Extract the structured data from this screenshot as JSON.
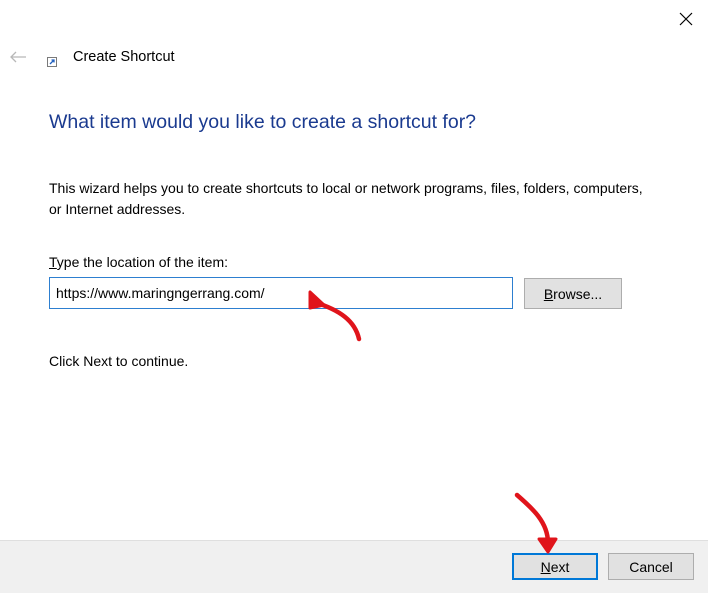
{
  "window": {
    "title": "Create Shortcut"
  },
  "wizard": {
    "heading": "What item would you like to create a shortcut for?",
    "description": "This wizard helps you to create shortcuts to local or network programs, files, folders, computers, or Internet addresses.",
    "location_label_access_key": "T",
    "location_label_rest": "ype the location of the item:",
    "location_value": "https://www.maringngerrang.com/",
    "browse_access_key": "B",
    "browse_rest": "rowse...",
    "hint": "Click Next to continue."
  },
  "footer": {
    "next_access_key": "N",
    "next_rest": "ext",
    "cancel_label": "Cancel"
  },
  "colors": {
    "heading": "#1a3a8f",
    "input_border": "#2d7fd0",
    "default_button_border": "#0078d7",
    "footer_background": "#f0f0f0",
    "annotation_arrow": "#e0141b"
  },
  "icons": {
    "close": "close-icon",
    "back": "back-arrow-icon",
    "title": "shortcut-icon"
  }
}
